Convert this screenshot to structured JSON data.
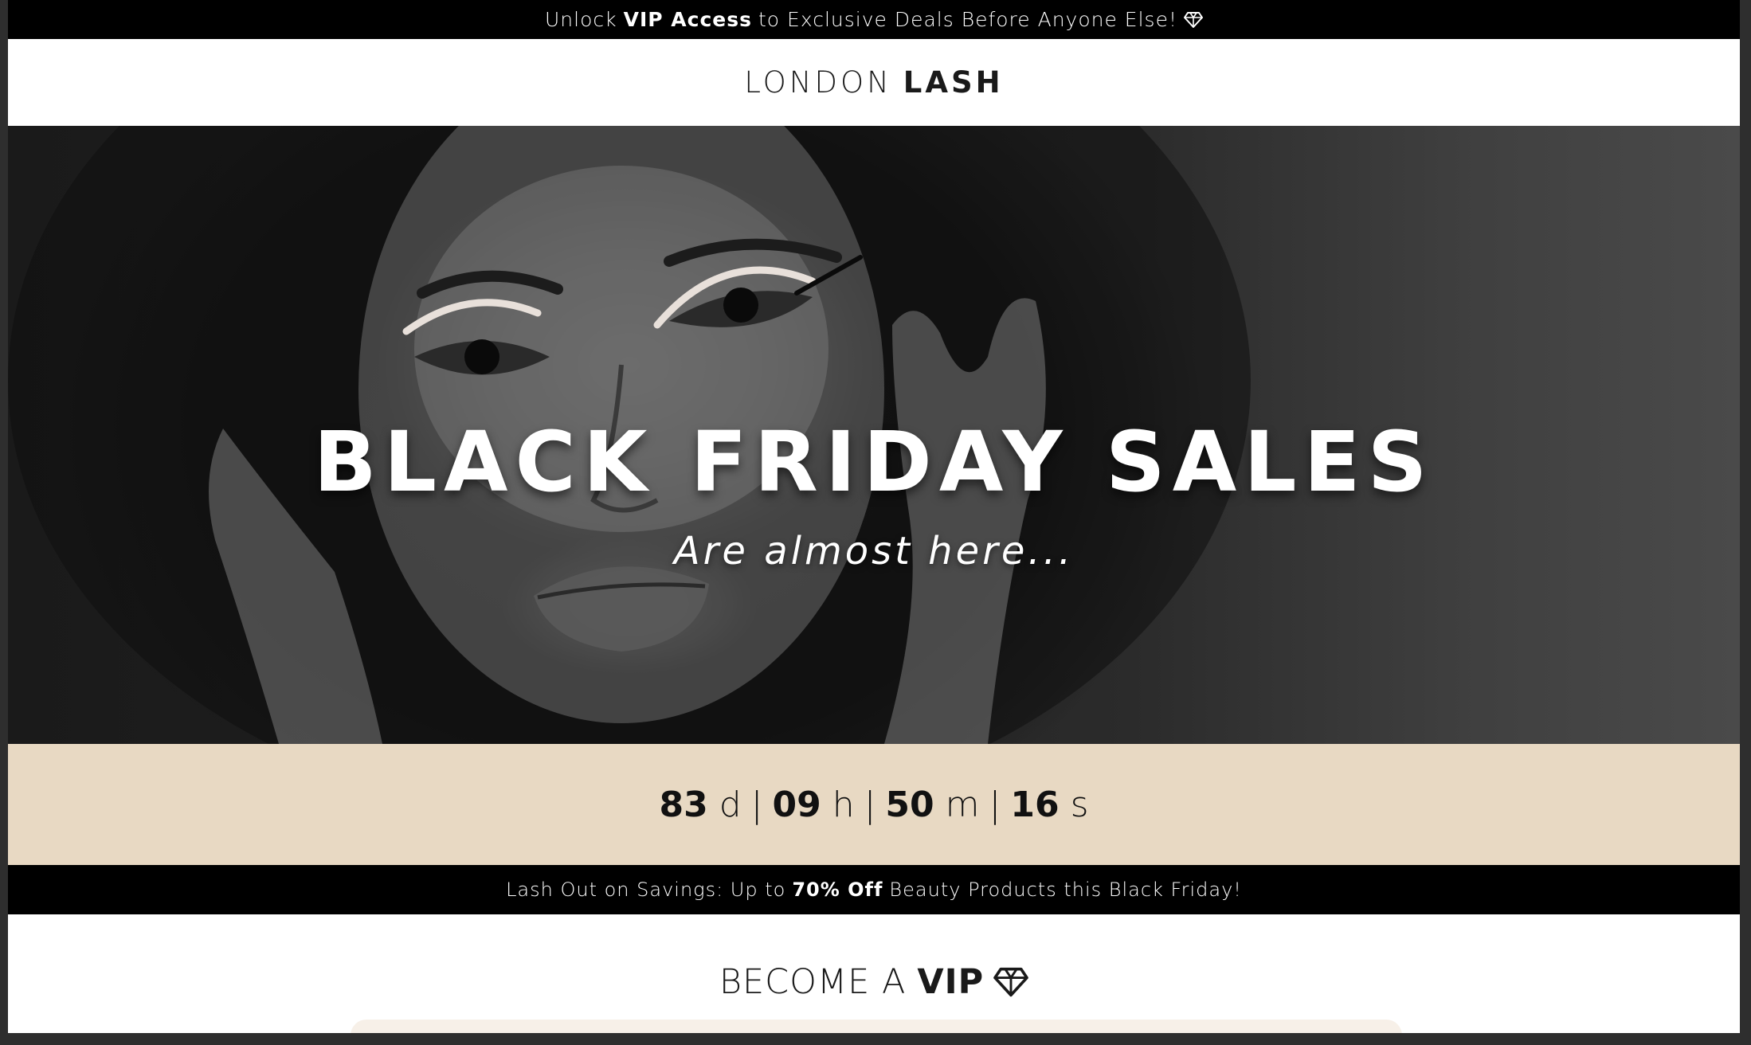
{
  "announcement": {
    "prefix": "Unlock",
    "highlight": "VIP Access",
    "suffix": "to Exclusive Deals Before Anyone Else!",
    "icon": "diamond-icon"
  },
  "header": {
    "logo_light": "LONDON",
    "logo_bold": "LASH"
  },
  "hero": {
    "title": "BLACK FRIDAY SALES",
    "subtitle": "Are almost here..."
  },
  "countdown": {
    "days": "83",
    "days_unit": "d",
    "hours": "09",
    "hours_unit": "h",
    "minutes": "50",
    "minutes_unit": "m",
    "seconds": "16",
    "seconds_unit": "s",
    "separator": "|"
  },
  "promo": {
    "prefix": "Lash Out on Savings: Up to",
    "highlight": "70% Off",
    "suffix": "Beauty Products this Black Friday!"
  },
  "vip": {
    "title_light": "BECOME A",
    "title_bold": "VIP",
    "icon": "diamond-icon"
  },
  "colors": {
    "bar_bg": "#000000",
    "countdown_bg": "#e8d9c3",
    "text_dark": "#1a1a1a"
  }
}
